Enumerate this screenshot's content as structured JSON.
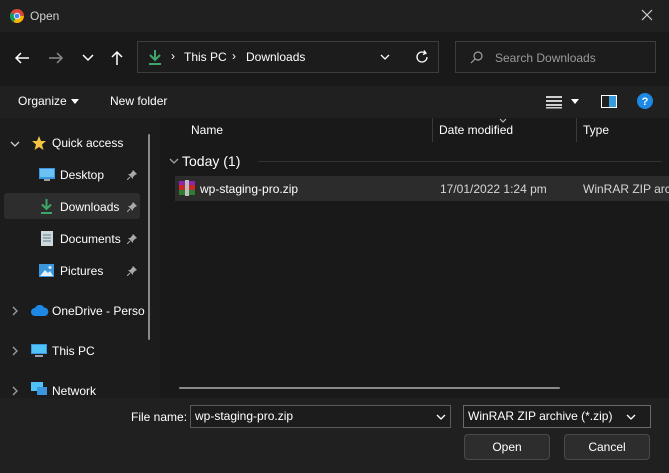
{
  "window": {
    "title": "Open"
  },
  "address_bar": {
    "segments": [
      "This PC",
      "Downloads"
    ]
  },
  "search": {
    "placeholder": "Search Downloads"
  },
  "toolbar": {
    "organize_label": "Organize",
    "new_folder_label": "New folder"
  },
  "nav_pane": {
    "quick_access": "Quick access",
    "items": [
      "Desktop",
      "Downloads",
      "Documents",
      "Pictures"
    ],
    "onedrive": "OneDrive - Perso",
    "this_pc": "This PC",
    "network": "Network"
  },
  "columns": {
    "name": "Name",
    "date_modified": "Date modified",
    "type": "Type"
  },
  "groups": [
    {
      "label": "Today (1)",
      "files": [
        {
          "name": "wp-staging-pro.zip",
          "date": "17/01/2022 1:24 pm",
          "type": "WinRAR ZIP archi"
        }
      ]
    }
  ],
  "bottom": {
    "filename_label": "File name:",
    "filename_value": "wp-staging-pro.zip",
    "filetype_value": "WinRAR ZIP archive (*.zip)",
    "open_label": "Open",
    "cancel_label": "Cancel"
  },
  "colors": {
    "accent": "#0078d4",
    "selected_row": "#2c2c2c",
    "window_bg": "#191919"
  }
}
